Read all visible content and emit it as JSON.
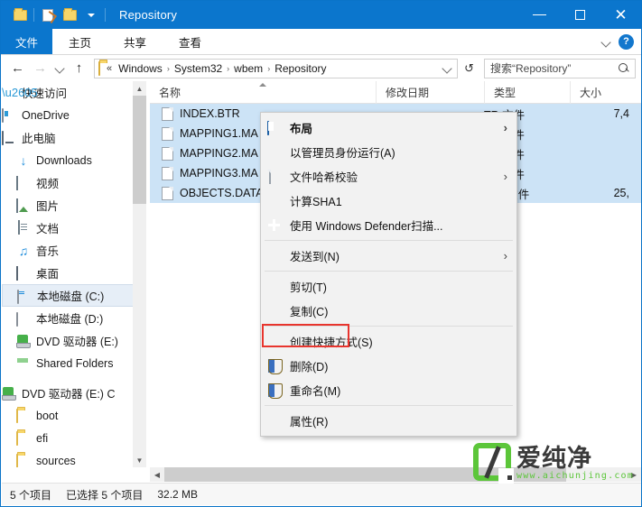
{
  "window": {
    "title": "Repository",
    "quick_access_icons": [
      "folder-icon",
      "properties-doc-icon",
      "new-folder-icon",
      "customize-chevron-icon"
    ],
    "controls": {
      "minimize": "─",
      "maximize": "□",
      "close": "✕"
    }
  },
  "ribbon": {
    "tabs": [
      {
        "label": "文件",
        "active": true
      },
      {
        "label": "主页",
        "active": false
      },
      {
        "label": "共享",
        "active": false
      },
      {
        "label": "查看",
        "active": false
      }
    ],
    "expand_icon": "chevron-down-icon",
    "help_icon": "?"
  },
  "address": {
    "back": "←",
    "forward": "→",
    "recent": "⌄",
    "up": "↑",
    "ellipsis": "«",
    "crumbs": [
      "Windows",
      "System32",
      "wbem",
      "Repository"
    ],
    "separator": "›",
    "dropdown": "⌄",
    "refresh": "↻"
  },
  "search": {
    "placeholder": "搜索“Repository”",
    "icon": "search-icon"
  },
  "columns": [
    {
      "label": "名称",
      "sorted": true
    },
    {
      "label": "修改日期",
      "sorted": false
    },
    {
      "label": "类型",
      "sorted": false
    },
    {
      "label": "大小",
      "sorted": false
    }
  ],
  "sidebar": {
    "items": [
      {
        "label": "快速访问",
        "icon": "pin-icon",
        "indent": 0,
        "selected": false
      },
      {
        "label": "OneDrive",
        "icon": "onedrive-icon",
        "indent": 0,
        "selected": false
      },
      {
        "label": "此电脑",
        "icon": "this-pc-icon",
        "indent": 0,
        "selected": false
      },
      {
        "label": "Downloads",
        "icon": "downloads-icon",
        "indent": 1,
        "selected": false
      },
      {
        "label": "视频",
        "icon": "videos-icon",
        "indent": 1,
        "selected": false
      },
      {
        "label": "图片",
        "icon": "pictures-icon",
        "indent": 1,
        "selected": false
      },
      {
        "label": "文档",
        "icon": "documents-icon",
        "indent": 1,
        "selected": false
      },
      {
        "label": "音乐",
        "icon": "music-icon",
        "indent": 1,
        "selected": false
      },
      {
        "label": "桌面",
        "icon": "desktop-icon",
        "indent": 1,
        "selected": false
      },
      {
        "label": "本地磁盘 (C:)",
        "icon": "system-drive-icon",
        "indent": 1,
        "selected": true
      },
      {
        "label": "本地磁盘 (D:)",
        "icon": "drive-icon",
        "indent": 1,
        "selected": false
      },
      {
        "label": "DVD 驱动器 (E:)",
        "icon": "dvd-drive-icon",
        "indent": 1,
        "selected": false
      },
      {
        "label": "Shared Folders",
        "icon": "shared-folders-icon",
        "indent": 1,
        "selected": false
      },
      {
        "label": "DVD 驱动器 (E:) C",
        "icon": "dvd-drive-icon",
        "indent": 0,
        "selected": false
      },
      {
        "label": "boot",
        "icon": "folder-icon",
        "indent": 1,
        "selected": false
      },
      {
        "label": "efi",
        "icon": "folder-icon",
        "indent": 1,
        "selected": false
      },
      {
        "label": "sources",
        "icon": "folder-icon",
        "indent": 1,
        "selected": false
      }
    ]
  },
  "files": [
    {
      "name": "INDEX.BTR",
      "date": "",
      "type": "TR 文件",
      "size": "7,4",
      "selected": true
    },
    {
      "name": "MAPPING1.MA",
      "date": "",
      "type": "AP 文件",
      "size": "",
      "selected": true
    },
    {
      "name": "MAPPING2.MA",
      "date": "",
      "type": "AP 文件",
      "size": "",
      "selected": true
    },
    {
      "name": "MAPPING3.MA",
      "date": "",
      "type": "AP 文件",
      "size": "",
      "selected": true
    },
    {
      "name": "OBJECTS.DATA",
      "date": "",
      "type": "ATA 文件",
      "size": "25,",
      "selected": true
    }
  ],
  "context_menu": [
    {
      "label": "布局",
      "icon": "layout-icon",
      "submenu": true,
      "bold": true,
      "separator_after": false
    },
    {
      "label": "以管理员身份运行(A)",
      "icon": "",
      "submenu": false,
      "bold": false,
      "separator_after": false
    },
    {
      "label": "文件哈希校验",
      "icon": "file-icon",
      "submenu": true,
      "bold": false,
      "separator_after": false
    },
    {
      "label": "计算SHA1",
      "icon": "",
      "submenu": false,
      "bold": false,
      "separator_after": false
    },
    {
      "label": "使用 Windows Defender扫描...",
      "icon": "defender-icon",
      "submenu": false,
      "bold": false,
      "separator_after": true
    },
    {
      "label": "发送到(N)",
      "icon": "",
      "submenu": true,
      "bold": false,
      "separator_after": true
    },
    {
      "label": "剪切(T)",
      "icon": "",
      "submenu": false,
      "bold": false,
      "separator_after": false
    },
    {
      "label": "复制(C)",
      "icon": "",
      "submenu": false,
      "bold": false,
      "separator_after": true
    },
    {
      "label": "创建快捷方式(S)",
      "icon": "",
      "submenu": false,
      "bold": false,
      "separator_after": false
    },
    {
      "label": "删除(D)",
      "icon": "shield-icon",
      "submenu": false,
      "bold": false,
      "separator_after": false,
      "highlighted": true
    },
    {
      "label": "重命名(M)",
      "icon": "shield-icon",
      "submenu": false,
      "bold": false,
      "separator_after": true
    },
    {
      "label": "属性(R)",
      "icon": "",
      "submenu": false,
      "bold": false,
      "separator_after": false
    }
  ],
  "status": {
    "item_count": "5 个项目",
    "selected_count": "已选择 5 个项目",
    "selected_size": "32.2 MB"
  },
  "watermark": {
    "name": "爱纯净",
    "url": "www.aichunjing.com",
    "color": "#5cc63a"
  },
  "colors": {
    "titlebar": "#0b76cd",
    "accent": "#0b76cd",
    "selection": "#cce3f6",
    "highlight_box": "#e8352e"
  }
}
